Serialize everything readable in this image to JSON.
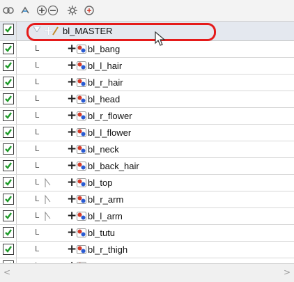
{
  "toolbar": {
    "icons": [
      {
        "name": "show-all-icon"
      },
      {
        "name": "lock-toggle-icon"
      },
      {
        "name": "expand-all-icon"
      },
      {
        "name": "collapse-all-icon"
      },
      {
        "name": "settings-icon"
      },
      {
        "name": "add-peg-icon"
      }
    ]
  },
  "master": {
    "label": "bl_MASTER",
    "checked": true,
    "highlight_color": "#e51a1a"
  },
  "layers": [
    {
      "label": "bl_bang",
      "checked": true,
      "indent": "L",
      "has_parent_mark": false
    },
    {
      "label": "bl_l_hair",
      "checked": true,
      "indent": "L",
      "has_parent_mark": false
    },
    {
      "label": "bl_r_hair",
      "checked": true,
      "indent": "L",
      "has_parent_mark": false
    },
    {
      "label": "bl_head",
      "checked": true,
      "indent": "L",
      "has_parent_mark": false
    },
    {
      "label": "bl_r_flower",
      "checked": true,
      "indent": "L",
      "has_parent_mark": false
    },
    {
      "label": "bl_l_flower",
      "checked": true,
      "indent": "L",
      "has_parent_mark": false
    },
    {
      "label": "bl_neck",
      "checked": true,
      "indent": "L",
      "has_parent_mark": false
    },
    {
      "label": "bl_back_hair",
      "checked": true,
      "indent": "L",
      "has_parent_mark": false
    },
    {
      "label": "bl_top",
      "checked": true,
      "indent": "L",
      "has_parent_mark": true
    },
    {
      "label": "bl_r_arm",
      "checked": true,
      "indent": "L",
      "has_parent_mark": true
    },
    {
      "label": "bl_l_arm",
      "checked": true,
      "indent": "L",
      "has_parent_mark": true
    },
    {
      "label": "bl_tutu",
      "checked": true,
      "indent": "L",
      "has_parent_mark": false
    },
    {
      "label": "bl_r_thigh",
      "checked": true,
      "indent": "L",
      "has_parent_mark": false
    },
    {
      "label": "",
      "checked": true,
      "indent": "L",
      "has_parent_mark": false
    }
  ],
  "scrollbar": {
    "left_arrow": "<",
    "right_arrow": ">"
  },
  "colors": {
    "check": "#1f9a2a",
    "peg_red": "#d23a2a",
    "peg_blue": "#2a5bd2"
  }
}
